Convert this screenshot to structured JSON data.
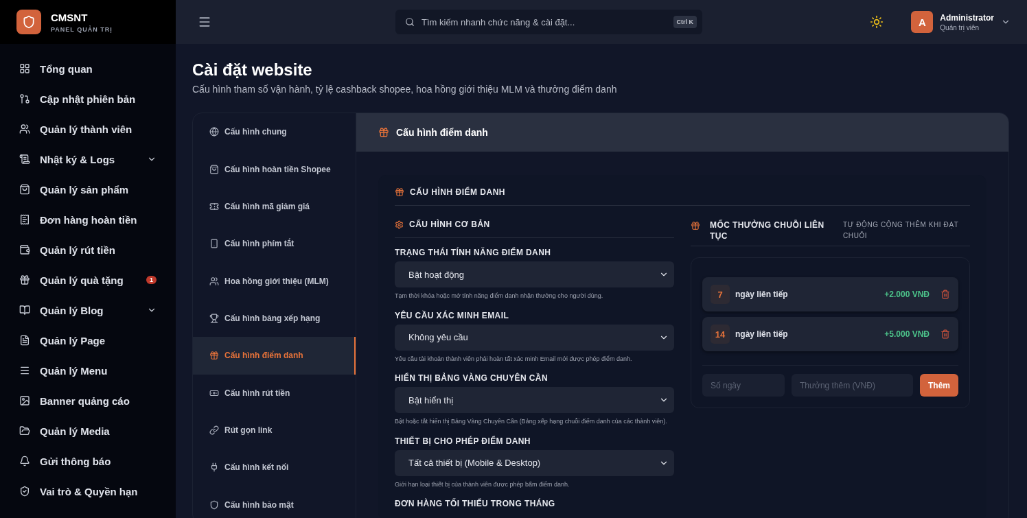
{
  "brand": {
    "name": "CMSNT",
    "subtitle": "PANEL QUẢN TRỊ"
  },
  "sidebar": {
    "items": [
      {
        "label": "Tổng quan",
        "expandable": false
      },
      {
        "label": "Cập nhật phiên bản",
        "expandable": false
      },
      {
        "label": "Quản lý thành viên",
        "expandable": false
      },
      {
        "label": "Nhật ký & Logs",
        "expandable": true
      },
      {
        "label": "Quản lý sản phẩm",
        "expandable": false
      },
      {
        "label": "Đơn hàng hoàn tiền",
        "expandable": false
      },
      {
        "label": "Quản lý rút tiền",
        "expandable": false
      },
      {
        "label": "Quản lý quà tặng",
        "expandable": false,
        "badge": "1"
      },
      {
        "label": "Quản lý Blog",
        "expandable": true
      },
      {
        "label": "Quản lý Page",
        "expandable": false
      },
      {
        "label": "Quản lý Menu",
        "expandable": false
      },
      {
        "label": "Banner quảng cáo",
        "expandable": false
      },
      {
        "label": "Quản lý Media",
        "expandable": false
      },
      {
        "label": "Gửi thông báo",
        "expandable": false
      },
      {
        "label": "Vai trò & Quyền hạn",
        "expandable": false
      }
    ]
  },
  "header": {
    "search": {
      "placeholder": "Tìm kiếm nhanh chức năng & cài đặt..."
    },
    "shortcut": "Ctrl K",
    "user": {
      "avatar": "A",
      "name": "Administrator",
      "role": "Quản trị viên"
    }
  },
  "page": {
    "title": "Cài đặt website",
    "subtitle": "Cấu hình tham số vận hành, tỷ lệ cashback shopee, hoa hồng giới thiệu MLM và thưởng điểm danh"
  },
  "settings_nav": [
    {
      "label": "Cấu hình chung",
      "selected": false
    },
    {
      "label": "Cấu hình hoàn tiền Shopee",
      "selected": false
    },
    {
      "label": "Cấu hình mã giảm giá",
      "selected": false
    },
    {
      "label": "Cấu hình phím tắt",
      "selected": false
    },
    {
      "label": "Hoa hồng giới thiệu (MLM)",
      "selected": false
    },
    {
      "label": "Cấu hình bảng xếp hạng",
      "selected": false
    },
    {
      "label": "Cấu hình điểm danh",
      "selected": true
    },
    {
      "label": "Cấu hình rút tiền",
      "selected": false
    },
    {
      "label": "Rút gọn link",
      "selected": false
    },
    {
      "label": "Cấu hình kết nối",
      "selected": false
    },
    {
      "label": "Cấu hình bảo mật",
      "selected": false
    }
  ],
  "panel": {
    "title": "Cấu hình điểm danh",
    "card_title": "CẤU HÌNH ĐIỂM DANH",
    "basic": {
      "title": "CẤU HÌNH CƠ BẢN",
      "fields": [
        {
          "label": "TRẠNG THÁI TÍNH NĂNG ĐIỂM DANH",
          "value": "Bật hoạt động",
          "hint": "Tạm thời khóa hoặc mở tính năng điểm danh nhận thưởng cho người dùng."
        },
        {
          "label": "YÊU CẦU XÁC MINH EMAIL",
          "value": "Không yêu cầu",
          "hint": "Yêu cầu tài khoản thành viên phải hoàn tất xác minh Email mới được phép điểm danh."
        },
        {
          "label": "HIỂN THỊ BẢNG VÀNG CHUYÊN CẦN",
          "value": "Bật hiển thị",
          "hint": "Bật hoặc tắt hiển thị Bảng Vàng Chuyên Cần (Bảng xếp hạng chuỗi điểm danh của các thành viên)."
        },
        {
          "label": "THIẾT BỊ CHO PHÉP ĐIỂM DANH",
          "value": "Tất cả thiết bị (Mobile & Desktop)",
          "hint": "Giới hạn loại thiết bị của thành viên được phép bấm điểm danh."
        },
        {
          "label": "ĐƠN HÀNG TỐI THIỂU TRONG THÁNG"
        }
      ]
    },
    "streak": {
      "title": "MỐC THƯỞNG CHUỖI LIÊN TỤC",
      "note": "TỰ ĐỘNG CỘNG THÊM KHI ĐẠT CHUỖI",
      "rewards": [
        {
          "days": "7",
          "text": "ngày liên tiếp",
          "amount": "+2.000 VNĐ"
        },
        {
          "days": "14",
          "text": "ngày liên tiếp",
          "amount": "+5.000 VNĐ"
        }
      ],
      "days_placeholder": "Số ngày",
      "bonus_placeholder": "Thưởng thêm (VNĐ)",
      "add_button": "Thêm"
    }
  }
}
